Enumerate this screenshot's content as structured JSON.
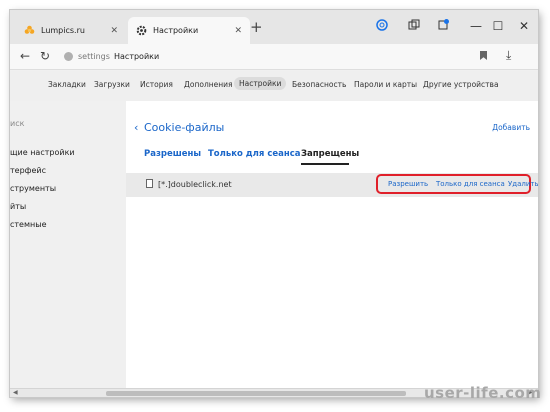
{
  "tabs": [
    {
      "title": "Lumpics.ru",
      "icon": "orange-flower-icon"
    },
    {
      "title": "Настройки",
      "icon": "gear-icon"
    }
  ],
  "window_controls": [
    "yandex-circle-icon",
    "tablet-icon",
    "notification-icon",
    "minimize-icon",
    "maximize-icon",
    "close-icon"
  ],
  "address": {
    "protocol": "settings",
    "title": "Настройки"
  },
  "settings_nav": [
    "Закладки",
    "Загрузки",
    "История",
    "Дополнения",
    "Настройки",
    "Безопасность",
    "Пароли и карты",
    "Другие устройства"
  ],
  "settings_nav_active": "Настройки",
  "sidebar": [
    "иск",
    "щие настройки",
    "терфейс",
    "струменты",
    "йты",
    "стемные"
  ],
  "panel": {
    "title": "Cookie-файлы",
    "add_label": "Добавить",
    "subtabs": [
      "Разрешены",
      "Только для сеанса",
      "Запрещены"
    ],
    "active_subtab": "Запрещены",
    "rows": [
      {
        "domain": "[*.]doubleclick.net",
        "actions": [
          "Разрешить",
          "Только для сеанса",
          "Удалить"
        ]
      }
    ]
  },
  "watermark": "user-life.com",
  "colors": {
    "link": "#1a66c9",
    "highlight_border": "#e0202a"
  }
}
